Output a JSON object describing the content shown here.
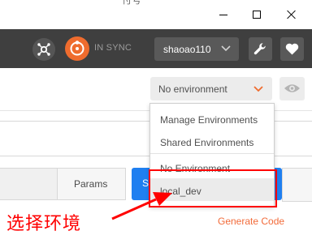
{
  "titlebar": {
    "tab_fragment": "付号"
  },
  "header": {
    "sync_status": "IN SYNC",
    "username": "shaoao110"
  },
  "environment": {
    "selected": "No environment"
  },
  "env_menu": {
    "items": [
      {
        "label": "Manage Environments"
      },
      {
        "label": "Shared Environments"
      },
      {
        "label": "No Environment"
      },
      {
        "label": "local_dev"
      }
    ]
  },
  "builder": {
    "params_label": "Params",
    "send_label_fragment": "S",
    "generate_code_label": "Generate Code"
  },
  "annotation": {
    "text": "选择环境",
    "color": "#ff0000"
  },
  "colors": {
    "header_bg": "#3f3f3f",
    "accent_orange": "#ef6c2e",
    "send_blue": "#1f7ff0"
  }
}
